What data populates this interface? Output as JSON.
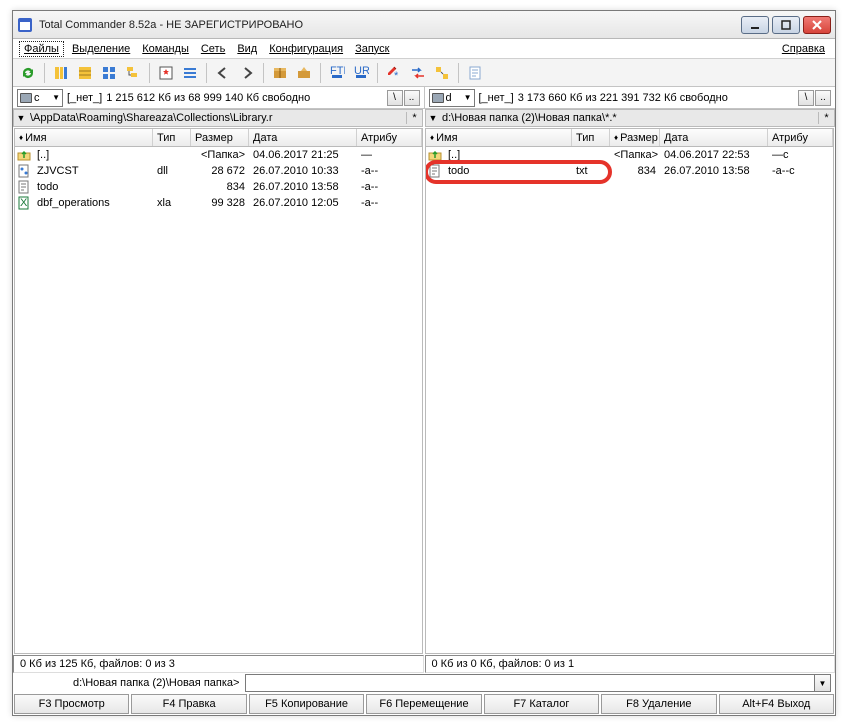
{
  "title": "Total Commander 8.52a - НЕ ЗАРЕГИСТРИРОВАНО",
  "menu": {
    "files": "Файлы",
    "selection": "Выделение",
    "commands": "Команды",
    "net": "Сеть",
    "view": "Вид",
    "config": "Конфигурация",
    "start": "Запуск",
    "help": "Справка"
  },
  "left": {
    "drive": "c",
    "nonelabel": "[_нет_]",
    "free": "1 215 612 Кб из 68 999 140 Кб свободно",
    "path": "\\AppData\\Roaming\\Shareaza\\Collections\\Library.r",
    "cols": {
      "name": "Имя",
      "ext": "Тип",
      "size": "Размер",
      "date": "Дата",
      "attr": "Атрибу"
    },
    "rows": [
      {
        "icon": "up",
        "name": "[..]",
        "ext": "",
        "size": "<Папка>",
        "date": "04.06.2017 21:25",
        "attr": "—"
      },
      {
        "icon": "dll",
        "name": "ZJVCST",
        "ext": "dll",
        "size": "28 672",
        "date": "26.07.2010 10:33",
        "attr": "-a--"
      },
      {
        "icon": "txt",
        "name": "todo",
        "ext": "",
        "size": "834",
        "date": "26.07.2010 13:58",
        "attr": "-a--"
      },
      {
        "icon": "xla",
        "name": "dbf_operations",
        "ext": "xla",
        "size": "99 328",
        "date": "26.07.2010 12:05",
        "attr": "-a--"
      }
    ],
    "status": "0 Кб из 125 Кб, файлов: 0 из 3"
  },
  "right": {
    "drive": "d",
    "nonelabel": "[_нет_]",
    "free": "3 173 660 Кб из 221 391 732 Кб свободно",
    "path": "d:\\Новая папка (2)\\Новая папка\\*.*",
    "cols": {
      "name": "Имя",
      "ext": "Тип",
      "size": "Размер",
      "date": "Дата",
      "attr": "Атрибу"
    },
    "rows": [
      {
        "icon": "up",
        "name": "[..]",
        "ext": "",
        "size": "<Папка>",
        "date": "04.06.2017 22:53",
        "attr": "—c"
      },
      {
        "icon": "txt",
        "name": "todo",
        "ext": "txt",
        "size": "834",
        "date": "26.07.2010 13:58",
        "attr": "-a--c"
      }
    ],
    "status": "0 Кб из 0 Кб, файлов: 0 из 1"
  },
  "cmdprompt": "d:\\Новая папка (2)\\Новая папка>",
  "fkeys": {
    "f3": "F3 Просмотр",
    "f4": "F4 Правка",
    "f5": "F5 Копирование",
    "f6": "F6 Перемещение",
    "f7": "F7 Каталог",
    "f8": "F8 Удаление",
    "altf4": "Alt+F4 Выход"
  }
}
